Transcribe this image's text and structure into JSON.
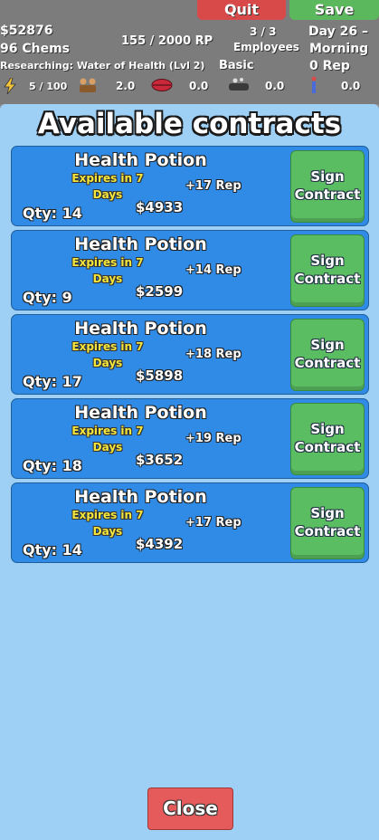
{
  "header": {
    "quit_label": "Quit",
    "save_label": "Save",
    "money": "$52876",
    "chems": "96 Chems",
    "rp": "155 / 2000 RP",
    "employees_count": "3 / 3",
    "employees_label": "Employees",
    "day": "Day 26 –",
    "time_of_day": "Morning",
    "researching": "Researching: Water of Health (Lvl 2)",
    "tier": "Basic",
    "rep": "0 Rep",
    "energy": "5 / 100",
    "stat2": "2.0",
    "stat3": "0.0",
    "stat4": "0.0",
    "stat5": "0.0"
  },
  "panel": {
    "title": "Available contracts",
    "close_label": "Close"
  },
  "contracts": [
    {
      "name": "Health Potion",
      "expires": "Expires in 7",
      "days": "Days",
      "rep": "+17 Rep",
      "price": "$4933",
      "qty": "Qty: 14",
      "sign_line1": "Sign",
      "sign_line2": "Contract"
    },
    {
      "name": "Health Potion",
      "expires": "Expires in 7",
      "days": "Days",
      "rep": "+14 Rep",
      "price": "$2599",
      "qty": "Qty: 9",
      "sign_line1": "Sign",
      "sign_line2": "Contract"
    },
    {
      "name": "Health Potion",
      "expires": "Expires in 7",
      "days": "Days",
      "rep": "+18 Rep",
      "price": "$5898",
      "qty": "Qty: 17",
      "sign_line1": "Sign",
      "sign_line2": "Contract"
    },
    {
      "name": "Health Potion",
      "expires": "Expires in 7",
      "days": "Days",
      "rep": "+19 Rep",
      "price": "$3652",
      "qty": "Qty: 18",
      "sign_line1": "Sign",
      "sign_line2": "Contract"
    },
    {
      "name": "Health Potion",
      "expires": "Expires in 7",
      "days": "Days",
      "rep": "+17 Rep",
      "price": "$4392",
      "qty": "Qty: 14",
      "sign_line1": "Sign",
      "sign_line2": "Contract"
    }
  ],
  "colors": {
    "panel_bg": "#9ed0f6",
    "card_bg": "#2f8be6",
    "sign_button": "#5bbd62",
    "close_button": "#e55b5b",
    "expires_text": "#f4e63a"
  },
  "icons": [
    "lightning-icon",
    "workers-icon",
    "lips-icon",
    "cauldron-icon",
    "person-icon"
  ]
}
